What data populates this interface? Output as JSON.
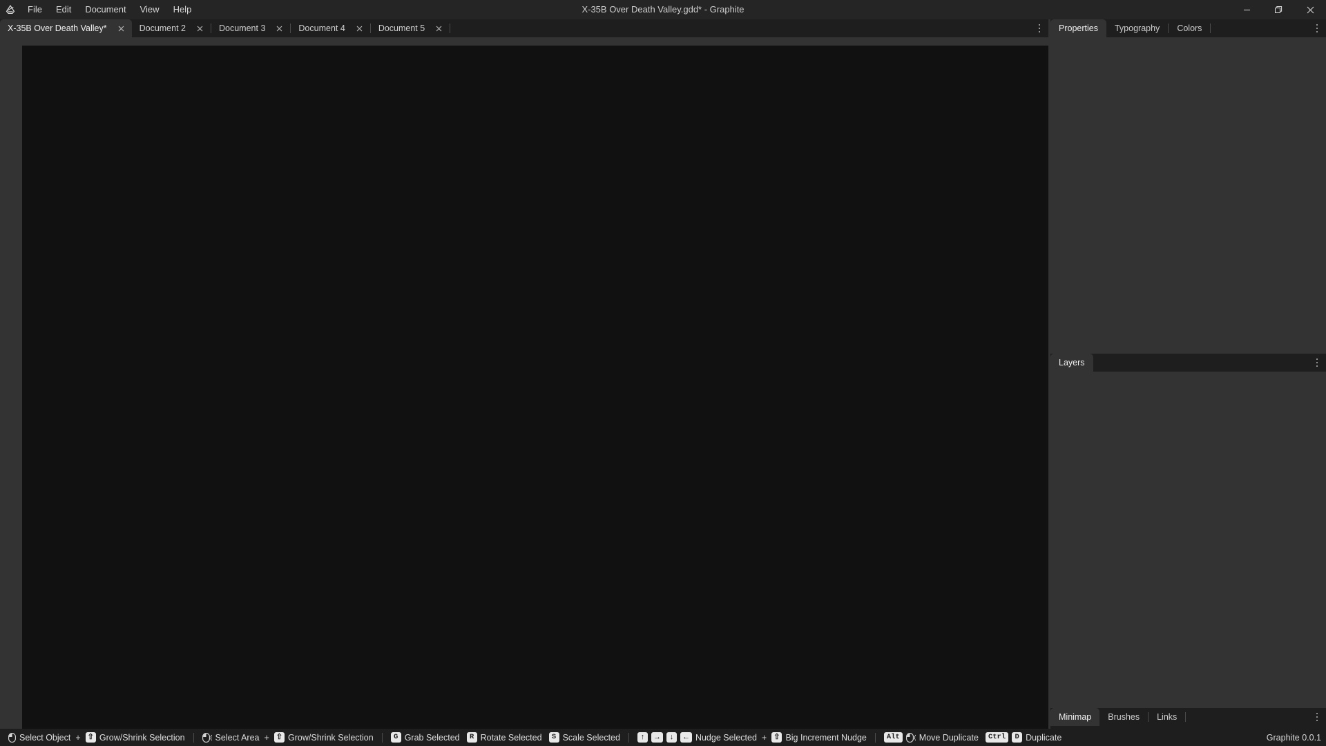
{
  "window": {
    "title": "X-35B Over Death Valley.gdd* - Graphite",
    "logo_icon": "graphite-logo-icon",
    "controls": [
      {
        "name": "minimize",
        "icon": "minimize-icon"
      },
      {
        "name": "maximize",
        "icon": "restore-icon"
      },
      {
        "name": "close",
        "icon": "close-icon"
      }
    ]
  },
  "menubar": {
    "items": [
      {
        "label": "File"
      },
      {
        "label": "Edit"
      },
      {
        "label": "Document"
      },
      {
        "label": "View"
      },
      {
        "label": "Help"
      }
    ]
  },
  "document_tabs": {
    "items": [
      {
        "label": "X-35B Over Death Valley*",
        "active": true,
        "close_icon": "close-icon"
      },
      {
        "label": "Document 2",
        "active": false,
        "close_icon": "close-icon"
      },
      {
        "label": "Document 3",
        "active": false,
        "close_icon": "close-icon"
      },
      {
        "label": "Document 4",
        "active": false,
        "close_icon": "close-icon"
      },
      {
        "label": "Document 5",
        "active": false,
        "close_icon": "close-icon"
      }
    ],
    "overflow_icon": "kebab-menu-icon"
  },
  "panels": {
    "properties": {
      "tabs": [
        {
          "label": "Properties",
          "active": true
        },
        {
          "label": "Typography",
          "active": false
        },
        {
          "label": "Colors",
          "active": false
        }
      ],
      "overflow_icon": "kebab-menu-icon"
    },
    "layers": {
      "tabs": [
        {
          "label": "Layers",
          "active": true
        }
      ],
      "overflow_icon": "kebab-menu-icon"
    },
    "minimap": {
      "tabs": [
        {
          "label": "Minimap",
          "active": true
        },
        {
          "label": "Brushes",
          "active": false
        },
        {
          "label": "Links",
          "active": false
        }
      ],
      "overflow_icon": "kebab-menu-icon"
    }
  },
  "statusbar": {
    "version": "Graphite 0.0.1",
    "hint_groups": [
      {
        "hints": [
          {
            "keys": [
              {
                "type": "mouse",
                "icon": "mouse-left-click-icon"
              }
            ],
            "label": "Select Object"
          },
          {
            "separator": "+"
          },
          {
            "keys": [
              {
                "type": "key",
                "label": "⇧"
              }
            ],
            "label": "Grow/Shrink Selection"
          }
        ]
      },
      {
        "hints": [
          {
            "keys": [
              {
                "type": "mouse",
                "icon": "mouse-left-drag-icon"
              }
            ],
            "label": "Select Area"
          },
          {
            "separator": "+"
          },
          {
            "keys": [
              {
                "type": "key",
                "label": "⇧"
              }
            ],
            "label": "Grow/Shrink Selection"
          }
        ]
      },
      {
        "hints": [
          {
            "keys": [
              {
                "type": "key",
                "label": "G"
              }
            ],
            "label": "Grab Selected"
          },
          {
            "keys": [
              {
                "type": "key",
                "label": "R"
              }
            ],
            "label": "Rotate Selected"
          },
          {
            "keys": [
              {
                "type": "key",
                "label": "S"
              }
            ],
            "label": "Scale Selected"
          }
        ]
      },
      {
        "hints": [
          {
            "keys": [
              {
                "type": "key",
                "label": "↑"
              },
              {
                "type": "key",
                "label": "→"
              },
              {
                "type": "key",
                "label": "↓"
              },
              {
                "type": "key",
                "label": "←"
              }
            ],
            "label": "Nudge Selected"
          },
          {
            "separator": "+"
          },
          {
            "keys": [
              {
                "type": "key",
                "label": "⇧"
              }
            ],
            "label": "Big Increment Nudge"
          }
        ]
      },
      {
        "hints": [
          {
            "keys": [
              {
                "type": "key",
                "label": "Alt"
              },
              {
                "type": "mouse",
                "icon": "mouse-left-drag-icon"
              }
            ],
            "label": "Move Duplicate"
          },
          {
            "keys": [
              {
                "type": "key",
                "label": "Ctrl"
              },
              {
                "type": "key",
                "label": "D"
              }
            ],
            "label": "Duplicate"
          }
        ]
      }
    ]
  },
  "colors": {
    "window_chrome": "#252525",
    "app_background": "#1e1e1e",
    "panel_background": "#333333",
    "viewport": "#111111",
    "text": "#d8d8d8",
    "keycap": "#e9e9e9"
  }
}
